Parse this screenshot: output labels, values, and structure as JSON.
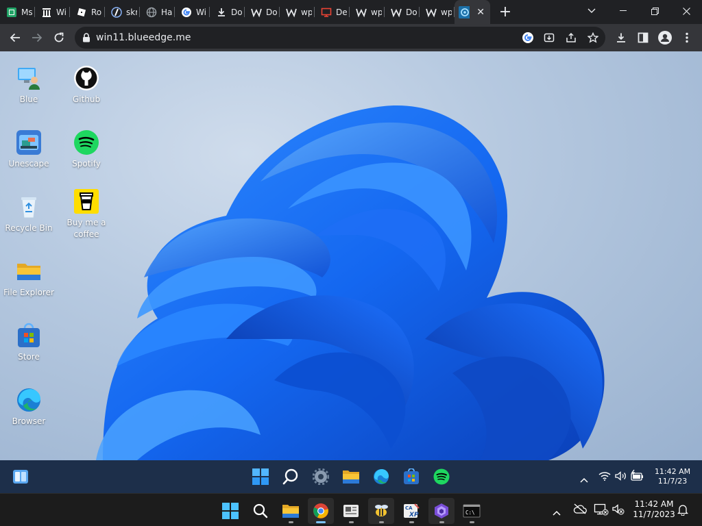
{
  "browser": {
    "tabs": [
      {
        "title": "Ms",
        "icon": "sheet-icon",
        "color": "#21a366"
      },
      {
        "title": "Wi",
        "icon": "archive-icon",
        "color": "#ffffff"
      },
      {
        "title": "Ro",
        "icon": "roblox-icon",
        "color": "#ffffff"
      },
      {
        "title": "skr",
        "icon": "feather-icon",
        "color": "#8ab4f8"
      },
      {
        "title": "Ha",
        "icon": "globe-icon",
        "color": "#9aa0a6"
      },
      {
        "title": "Wi",
        "icon": "google-icon",
        "color": "#4285f4"
      },
      {
        "title": "Do",
        "icon": "download-icon",
        "color": "#e8eaed"
      },
      {
        "title": "Do",
        "icon": "w-icon",
        "color": "#e8eaed"
      },
      {
        "title": "wp",
        "icon": "w-icon",
        "color": "#e8eaed"
      },
      {
        "title": "De",
        "icon": "monitor-icon",
        "color": "#ea4335"
      },
      {
        "title": "wp",
        "icon": "w-icon",
        "color": "#e8eaed"
      },
      {
        "title": "Do",
        "icon": "w-icon",
        "color": "#e8eaed"
      },
      {
        "title": "wp",
        "icon": "w-icon",
        "color": "#e8eaed"
      }
    ],
    "active_tab": {
      "title": "win11.blueedge.me",
      "icon": "blueedge-icon"
    },
    "url": "win11.blueedge.me"
  },
  "desktop": {
    "icons": [
      {
        "label": "Blue",
        "icon": "user-pc-icon"
      },
      {
        "label": "Github",
        "icon": "github-icon"
      },
      {
        "label": "Unescape",
        "icon": "unescape-icon"
      },
      {
        "label": "Spotify",
        "icon": "spotify-icon"
      },
      {
        "label": "Recycle Bin",
        "icon": "recycle-bin-icon"
      },
      {
        "label": "Buy me a coffee",
        "icon": "coffee-icon"
      },
      {
        "label": "File Explorer",
        "icon": "folder-icon"
      },
      {
        "label": "Store",
        "icon": "store-icon"
      },
      {
        "label": "Browser",
        "icon": "edge-icon"
      }
    ]
  },
  "inner_taskbar": {
    "time": "11:42 AM",
    "date": "11/7/23"
  },
  "host_taskbar": {
    "time": "11:42 AM",
    "date": "11/7/2023"
  },
  "colors": {
    "win_blue": "#0078d4",
    "spotify_green": "#1ed760",
    "folder_yellow": "#f8c537"
  }
}
